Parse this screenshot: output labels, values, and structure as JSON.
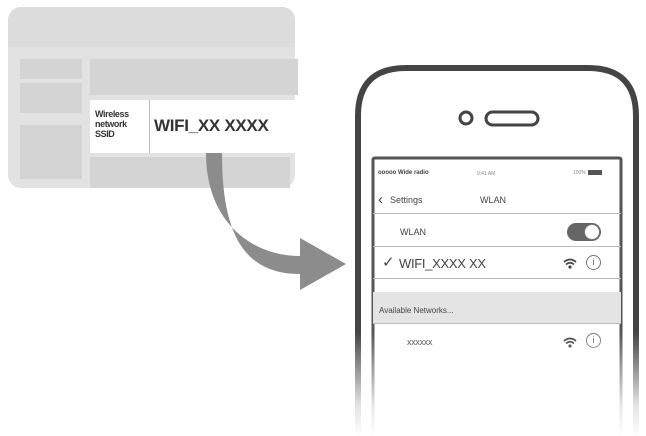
{
  "label_card": {
    "ssid_label_lines": [
      "Wireless",
      "network",
      "SSID"
    ],
    "ssid_value": "WIFI_XX XXXX"
  },
  "phone": {
    "status_bar": {
      "carrier": "ooooo Wide radio",
      "clock": "9:41 AM",
      "battery": "100%"
    },
    "nav": {
      "back_label": "Settings",
      "title": "WLAN"
    },
    "wlan_row": {
      "label": "WLAN",
      "toggle_on": true
    },
    "connected_network": {
      "name": "WIFI_XXXX XX",
      "check_glyph": "✓",
      "wifi_icon": "wifi-signal-icon",
      "info_icon": "info-icon"
    },
    "available_header": "Available Networks...",
    "available_networks": [
      {
        "name": "xxxxxx",
        "wifi_icon": "wifi-signal-icon",
        "info_icon": "info-icon"
      }
    ]
  },
  "colors": {
    "card_background": "#e2e2e2",
    "card_cell": "#d4d4d4",
    "arrow": "#8c8c8c",
    "phone_outline": "#444444",
    "toggle_on": "#666666"
  }
}
